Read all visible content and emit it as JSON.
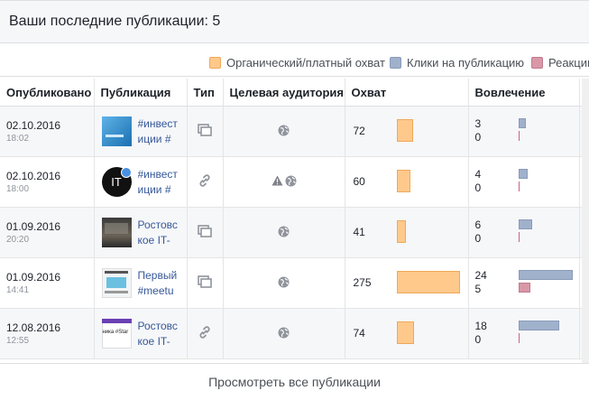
{
  "header": {
    "title": "Ваши последние публикации: 5"
  },
  "legend": [
    {
      "label": "Органический/платный охват",
      "color": "#ffc98c",
      "border": "#f0a85a"
    },
    {
      "label": "Клики на публикацию",
      "color": "#a0b1cc",
      "border": "#8a9bb8"
    },
    {
      "label": "Реакции",
      "color": "#d898a8",
      "border": "#c07a8c"
    }
  ],
  "columns": [
    "Опубликовано",
    "Публикация",
    "Тип",
    "Целевая аудитория",
    "Охват",
    "Вовлечение"
  ],
  "posts": [
    {
      "date": "02.10.2016",
      "time": "18:02",
      "title": "#инвестиции #",
      "thumb": "blue-photo",
      "type_icon": "album-icon",
      "audience_icons": [
        "globe-icon"
      ],
      "reach": 72,
      "clicks": 3,
      "reactions": 0
    },
    {
      "date": "02.10.2016",
      "time": "18:00",
      "title": "#инвестиции #",
      "thumb": "it-logo",
      "thumb_text": "IT",
      "type_icon": "link-icon",
      "audience_icons": [
        "warning-icon",
        "globe-icon"
      ],
      "reach": 60,
      "clicks": 4,
      "reactions": 0
    },
    {
      "date": "01.09.2016",
      "time": "20:20",
      "title": "Ростовское IT-",
      "thumb": "dark-photo",
      "type_icon": "album-icon",
      "audience_icons": [
        "globe-icon"
      ],
      "reach": 41,
      "clicks": 6,
      "reactions": 0
    },
    {
      "date": "01.09.2016",
      "time": "14:41",
      "title": "Первый #meetu",
      "thumb": "meetup-photo",
      "type_icon": "album-icon",
      "audience_icons": [
        "globe-icon"
      ],
      "reach": 275,
      "clicks": 24,
      "reactions": 5
    },
    {
      "date": "12.08.2016",
      "time": "12:55",
      "title": "Ростовское IT-",
      "thumb": "text-photo",
      "thumb_text": "ника #Star",
      "type_icon": "link-icon",
      "audience_icons": [
        "globe-icon"
      ],
      "reach": 74,
      "clicks": 18,
      "reactions": 0
    }
  ],
  "scale": {
    "reach_max": 275,
    "engagement_max": 24
  },
  "footer": {
    "view_all": "Просмотреть все публикации"
  }
}
